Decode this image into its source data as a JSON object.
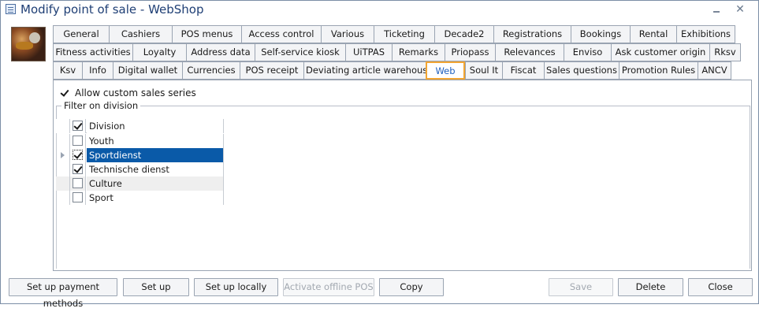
{
  "window": {
    "title": "Modify point of sale - WebShop"
  },
  "tabs": {
    "row1": [
      "General",
      "Cashiers",
      "POS menus",
      "Access control",
      "Various",
      "Ticketing",
      "Decade2",
      "Registrations",
      "Bookings",
      "Rental",
      "Exhibitions"
    ],
    "row2": [
      "Fitness activities",
      "Loyalty",
      "Address data",
      "Self-service kiosk",
      "UiTPAS",
      "Remarks",
      "Priopass",
      "Relevances",
      "Enviso",
      "Ask customer origin",
      "Rksv"
    ],
    "row3": [
      "Ksv",
      "Info",
      "Digital wallet",
      "Currencies",
      "POS receipt",
      "Deviating article warehouses",
      "Web",
      "Soul It",
      "Fiscat",
      "Sales questions",
      "Promotion Rules",
      "ANCV"
    ],
    "active": "Web"
  },
  "web": {
    "allow_custom_label": "Allow custom sales series",
    "allow_custom_checked": true,
    "filter_title": "Filter on division",
    "grid": {
      "header": {
        "label": "Division",
        "checked": true
      },
      "rows": [
        {
          "label": "Youth",
          "checked": false
        },
        {
          "label": "Sportdienst",
          "checked": true,
          "selected": true
        },
        {
          "label": "Technische dienst",
          "checked": true
        },
        {
          "label": "Culture",
          "checked": false
        },
        {
          "label": "Sport",
          "checked": false
        }
      ]
    }
  },
  "buttons": {
    "setup_payment": "Set up payment methods",
    "setup": "Set up",
    "setup_locally": "Set up locally",
    "activate_offline": "Activate offline POS",
    "copy": "Copy",
    "save": "Save",
    "delete": "Delete",
    "close": "Close"
  }
}
